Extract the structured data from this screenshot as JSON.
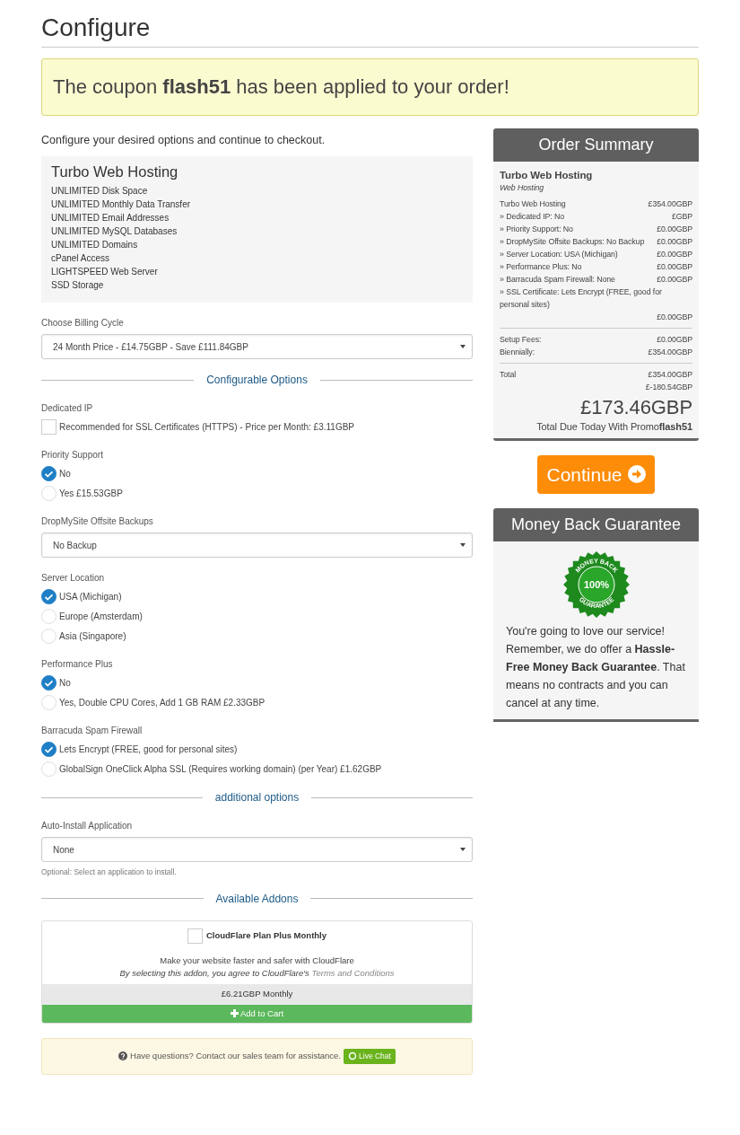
{
  "title": "Configure",
  "coupon_alert": "The coupon **flash51** has been applied to your order!",
  "intro": "Configure your desired options and continue to checkout.",
  "product": {
    "name": "Turbo Web Hosting",
    "features": [
      "UNLIMITED Disk Space",
      "UNLIMITED Monthly Data Transfer",
      "UNLIMITED Email Addresses",
      "UNLIMITED MySQL Databases",
      "UNLIMITED Domains",
      "cPanel Access",
      "LIGHTSPEED Web Server",
      "SSD Storage"
    ]
  },
  "billing_cycle": {
    "label": "Choose Billing Cycle",
    "value": "24 Month Price - £14.75GBP - Save £111.84GBP"
  },
  "configurable_heading": "Configurable Options",
  "options": [
    {
      "kind": "checkbox",
      "label": "Dedicated IP",
      "text": "Recommended for SSL Certificates (HTTPS) - Price per Month: £3.11GBP",
      "checked": false
    },
    {
      "kind": "radio",
      "label": "Priority Support",
      "choices": [
        {
          "text": "No",
          "selected": true
        },
        {
          "text": "Yes £15.53GBP",
          "selected": false
        }
      ]
    },
    {
      "kind": "select",
      "label": "DropMySite Offsite Backups",
      "value": "No Backup"
    },
    {
      "kind": "radio",
      "label": "Server Location",
      "choices": [
        {
          "text": "USA (Michigan)",
          "selected": true
        },
        {
          "text": "Europe (Amsterdam)",
          "selected": false
        },
        {
          "text": "Asia (Singapore)",
          "selected": false
        }
      ]
    },
    {
      "kind": "radio",
      "label": "Performance Plus",
      "choices": [
        {
          "text": "No",
          "selected": true
        },
        {
          "text": "Yes, Double CPU Cores, Add 1 GB RAM £2.33GBP",
          "selected": false
        }
      ]
    },
    {
      "kind": "radio",
      "label": "Barracuda Spam Firewall",
      "choices": [
        {
          "text": "Lets Encrypt (FREE, good for personal sites)",
          "selected": true
        },
        {
          "text": "GlobalSign OneClick Alpha SSL (Requires working domain) (per Year) £1.62GBP",
          "selected": false
        }
      ]
    }
  ],
  "additional_heading": "additional options",
  "auto_install": {
    "label": "Auto-Install Application",
    "value": "None",
    "help": "Optional: Select an application to install."
  },
  "addons_heading": "Available Addons",
  "addon": {
    "name": "CloudFlare Plan Plus Monthly",
    "checked": false,
    "description": "Make your website faster and safer with CloudFlare",
    "terms": "By selecting this addon, you agree to CloudFlare's",
    "terms_link": "Terms and Conditions",
    "price": "£6.21GBP Monthly",
    "button": "Add to Cart"
  },
  "help_bar": {
    "text": "Have questions? Contact our sales team for assistance.",
    "button": "Live Chat"
  },
  "order_summary": {
    "title": "Order Summary",
    "product": "Turbo Web Hosting",
    "group": "Web Hosting",
    "items": [
      {
        "label": "Turbo Web Hosting",
        "price": "£354.00GBP"
      },
      {
        "label": "» Dedicated IP: No",
        "price": "£GBP"
      },
      {
        "label": "» Priority Support: No",
        "price": "£0.00GBP"
      },
      {
        "label": "» DropMySite Offsite Backups: No Backup",
        "price": "£0.00GBP"
      },
      {
        "label": "» Server Location: USA (Michigan)",
        "price": "£0.00GBP"
      },
      {
        "label": "» Performance Plus: No",
        "price": "£0.00GBP"
      },
      {
        "label": "» Barracuda Spam Firewall: None",
        "price": "£0.00GBP"
      },
      {
        "label": "» SSL Certificate: Lets Encrypt (FREE, good for personal sites)",
        "price": "£0.00GBP"
      }
    ],
    "fees": [
      {
        "label": "Setup Fees:",
        "price": "£0.00GBP"
      },
      {
        "label": "Biennially:",
        "price": "£354.00GBP"
      }
    ],
    "total_label": "Total",
    "total_values": [
      "£354.00GBP",
      "£-180.54GBP"
    ],
    "total_due": "£173.46GBP",
    "total_due_note": "Total Due Today With Promo**flash51**"
  },
  "continue_button": "Continue",
  "guarantee": {
    "title": "Money Back Guarantee",
    "seal_top": "MONEY BACK",
    "seal_center": "100%",
    "seal_bottom": "GUARANTEE",
    "text": "You're going to love our service! Remember, we do offer a **Hassle-Free Money Back Guarantee**. That means no contracts and you can cancel at any time."
  }
}
